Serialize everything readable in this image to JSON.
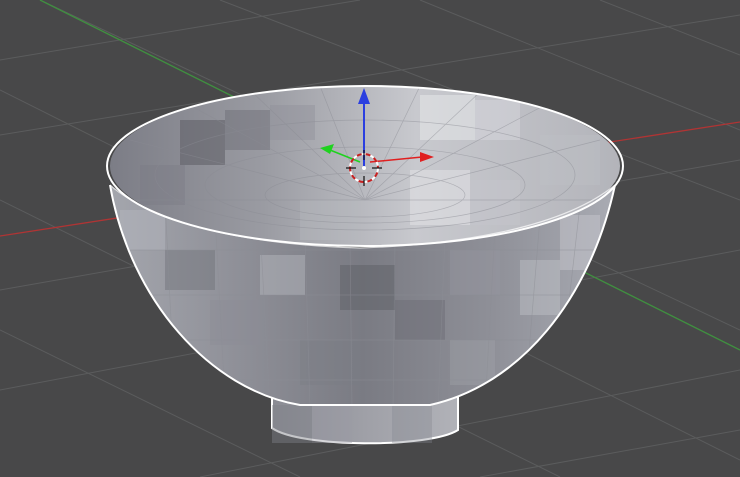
{
  "viewport": {
    "background": "#484849",
    "grid_line_color": "#595a5b",
    "axis_x_color": "#b03434",
    "axis_y_color": "#3f8f3f"
  },
  "object": {
    "name_icon": "bowl-mesh",
    "selected": true,
    "outline_color": "#ffffff",
    "shade_light": "#c9cacf",
    "shade_dark": "#6c6d75"
  },
  "gizmo": {
    "z_arrow_color": "#2b3fe0",
    "x_arrow_color": "#e02020",
    "y_arrow_color": "#1fd21f"
  },
  "cursor_3d": {
    "icon": "3d-cursor-icon"
  }
}
